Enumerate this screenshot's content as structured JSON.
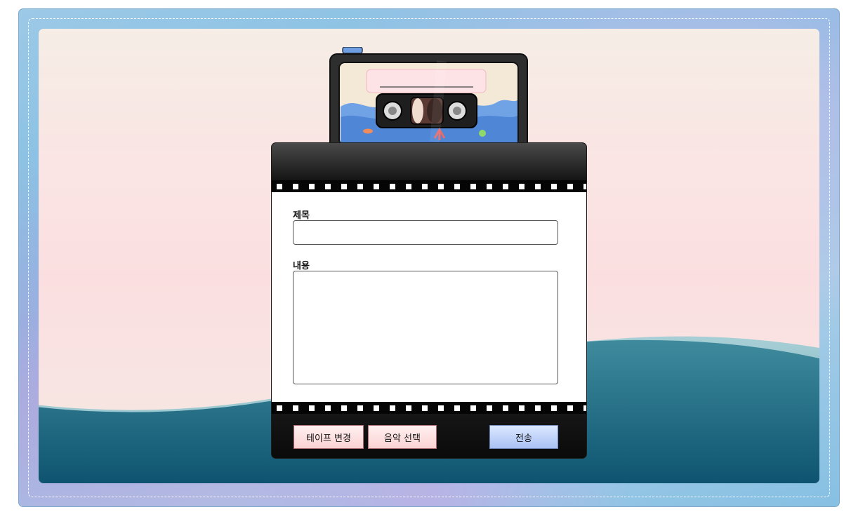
{
  "form": {
    "title_label": "제목",
    "title_value": "",
    "content_label": "내용",
    "content_value": ""
  },
  "buttons": {
    "change_tape": "테이프 변경",
    "select_music": "음악 선택",
    "submit": "전송"
  },
  "colors": {
    "frame_blue": "#86c0e3",
    "wave_teal": "#1f6a80",
    "button_pink": "#fbd3d4",
    "button_blue": "#a9c1f4"
  }
}
